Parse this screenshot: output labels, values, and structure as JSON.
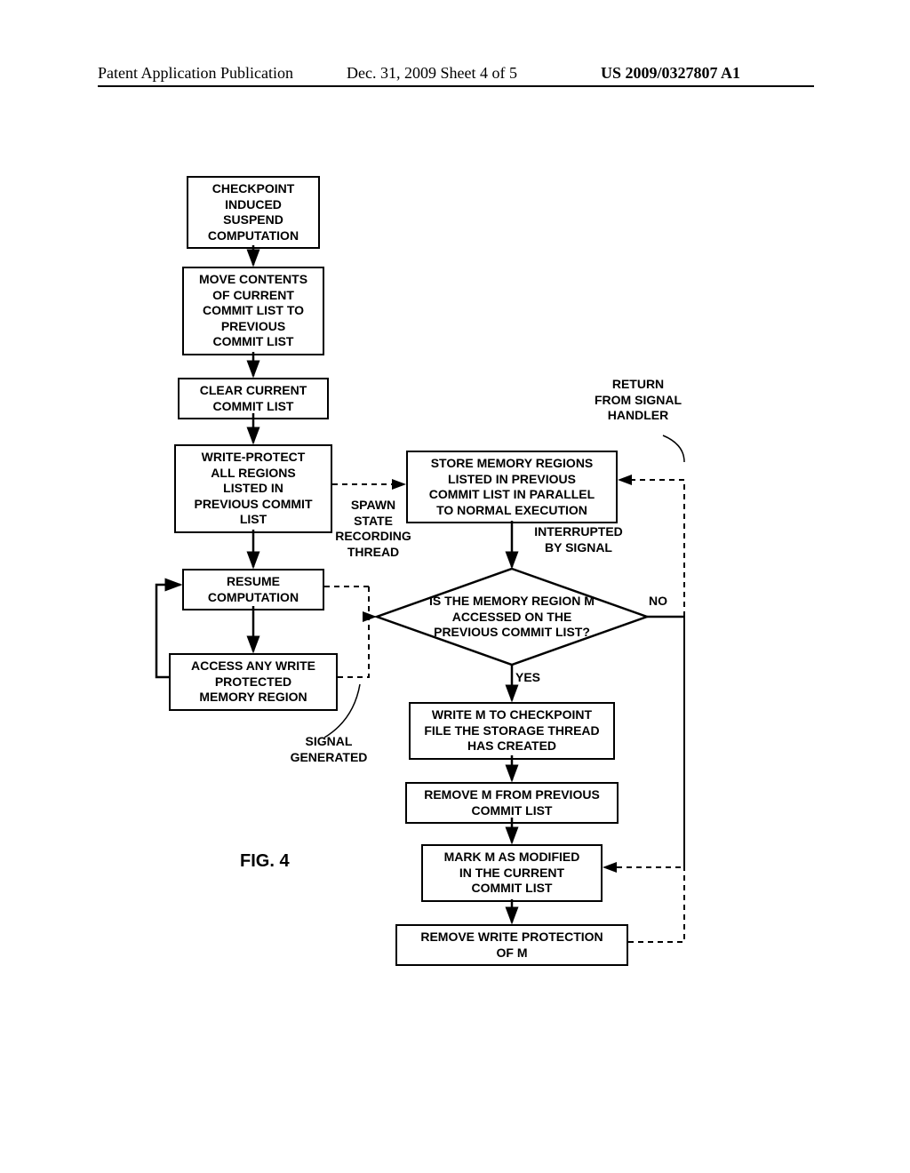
{
  "header": {
    "left": "Patent Application Publication",
    "center": "Dec. 31, 2009  Sheet 4 of 5",
    "right": "US 2009/0327807 A1"
  },
  "boxes": {
    "checkpoint": "CHECKPOINT\nINDUCED\nSUSPEND\nCOMPUTATION",
    "move": "MOVE CONTENTS\nOF CURRENT\nCOMMIT LIST TO\nPREVIOUS\nCOMMIT LIST",
    "clear": "CLEAR CURRENT\nCOMMIT LIST",
    "writeprotect": "WRITE-PROTECT\nALL REGIONS\nLISTED IN\nPREVIOUS COMMIT\nLIST",
    "resume": "RESUME\nCOMPUTATION",
    "access": "ACCESS ANY WRITE\nPROTECTED\nMEMORY REGION",
    "store": "STORE MEMORY REGIONS\nLISTED IN PREVIOUS\nCOMMIT LIST IN PARALLEL\nTO NORMAL EXECUTION",
    "writeM": "WRITE M TO CHECKPOINT\nFILE THE STORAGE THREAD\nHAS CREATED",
    "removeM": "REMOVE M FROM PREVIOUS\nCOMMIT LIST",
    "markM": "MARK M AS MODIFIED\nIN THE CURRENT\nCOMMIT LIST",
    "removeWP": "REMOVE WRITE PROTECTION\nOF M"
  },
  "diamond": {
    "text": "IS THE MEMORY REGION M\nACCESSED ON THE\nPREVIOUS COMMIT LIST?"
  },
  "labels": {
    "return": "RETURN\nFROM SIGNAL\nHANDLER",
    "spawn": "SPAWN\nSTATE\nRECORDING\nTHREAD",
    "interrupted": "INTERRUPTED\nBY SIGNAL",
    "signalgen": "SIGNAL\nGENERATED",
    "yes": "YES",
    "no": "NO"
  },
  "figure": "FIG. 4"
}
